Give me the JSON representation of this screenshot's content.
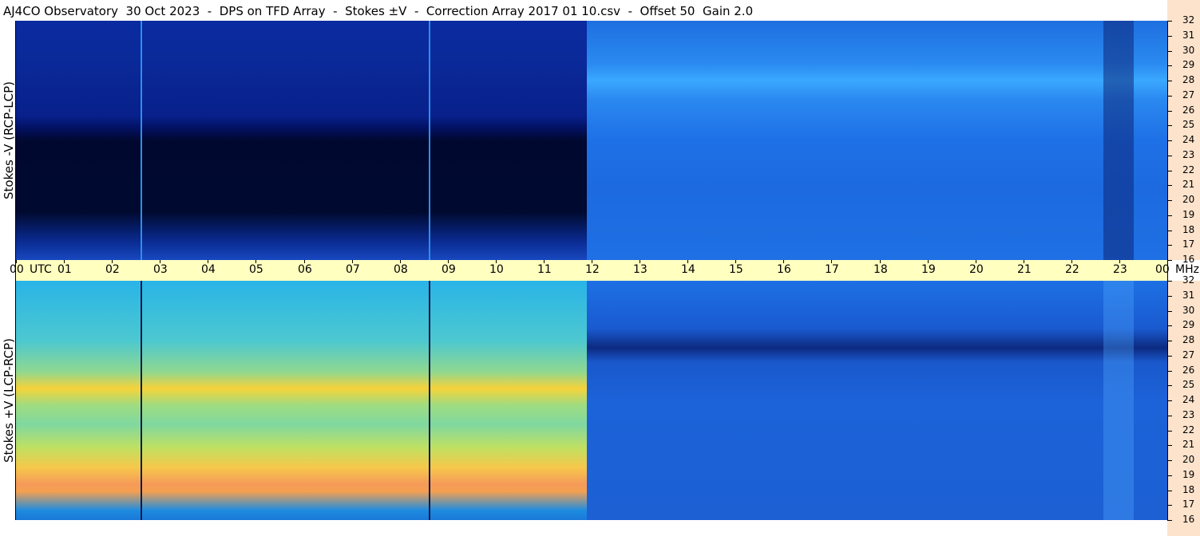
{
  "title": "AJ4CO Observatory  30 Oct 2023  -  DPS on TFD Array  -  Stokes ±V  -  Correction Array 2017 01 10.csv  -  Offset 50  Gain 2.0",
  "panels": {
    "top_label": "Stokes -V (RCP-LCP)",
    "bottom_label": "Stokes +V (LCP-RCP)"
  },
  "colors": {
    "background": "#ffffff",
    "utc_bar": "#ffffc0",
    "mhz_strip": "#fde3cc"
  },
  "chart_data": {
    "type": "heatmap",
    "xlabel": "UTC",
    "ylabel_unit": "MHz",
    "x_ticks": [
      "00",
      "01",
      "02",
      "03",
      "04",
      "05",
      "06",
      "07",
      "08",
      "09",
      "10",
      "11",
      "12",
      "13",
      "14",
      "15",
      "16",
      "17",
      "18",
      "19",
      "20",
      "21",
      "22",
      "23",
      "00"
    ],
    "y_ticks": [
      "32",
      "31",
      "30",
      "29",
      "28",
      "27",
      "26",
      "25",
      "24",
      "23",
      "22",
      "21",
      "20",
      "19",
      "18",
      "17",
      "16"
    ],
    "xlim_hours": [
      0,
      24
    ],
    "ylim_mhz": [
      16,
      32
    ],
    "colormap": "jet",
    "vertical_markers_utc_hours": [
      2.6,
      8.6
    ],
    "transition_utc_hour": 11.9
  }
}
